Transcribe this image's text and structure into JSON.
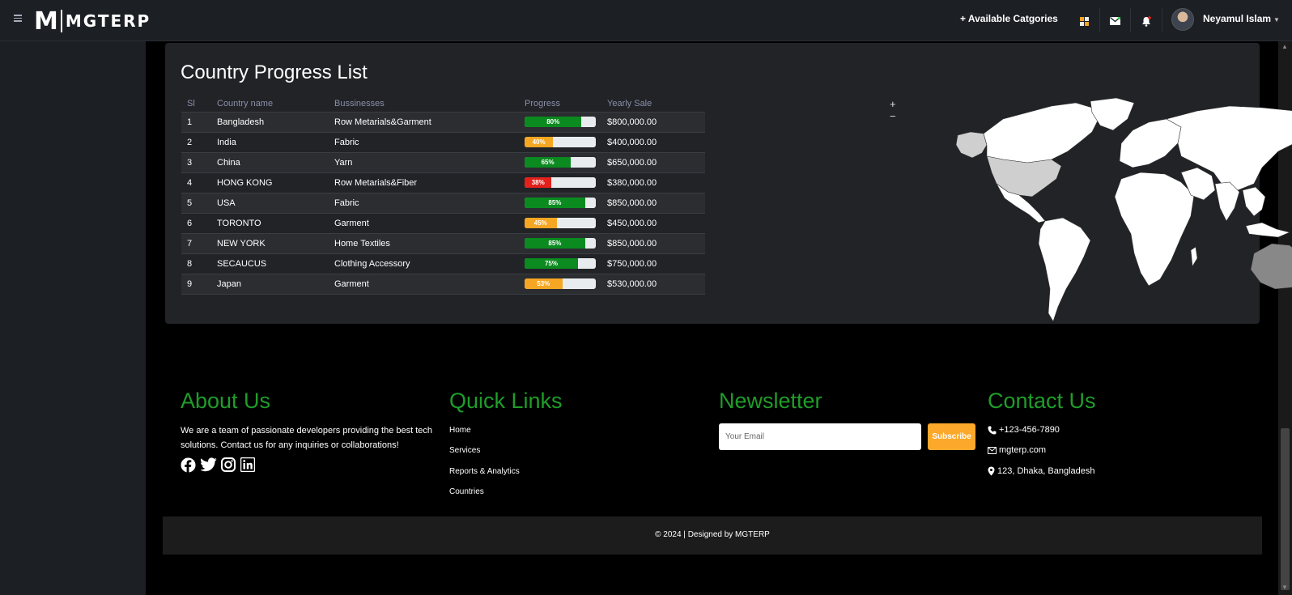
{
  "header": {
    "logo_letter": "M",
    "logo_text": "MGTERP",
    "available_categories": "+ Available Catgories",
    "icons": [
      "grid-icon",
      "mail-icon",
      "bell-icon"
    ],
    "user_name": "Neyamul Islam"
  },
  "card": {
    "title": "Country Progress List",
    "columns": [
      "Sl",
      "Country name",
      "Bussinesses",
      "Progress",
      "Yearly Sale"
    ],
    "rows": [
      {
        "sl": "1",
        "country": "Bangladesh",
        "business": "Row Metarials&Garment",
        "progress": 80,
        "progress_label": "80%",
        "color": "#0a8a1f",
        "sale": "$800,000.00"
      },
      {
        "sl": "2",
        "country": "India",
        "business": "Fabric",
        "progress": 40,
        "progress_label": "40%",
        "color": "#f5a623",
        "sale": "$400,000.00"
      },
      {
        "sl": "3",
        "country": "China",
        "business": "Yarn",
        "progress": 65,
        "progress_label": "65%",
        "color": "#0a8a1f",
        "sale": "$650,000.00"
      },
      {
        "sl": "4",
        "country": "HONG KONG",
        "business": "Row Metarials&Fiber",
        "progress": 38,
        "progress_label": "38%",
        "color": "#e3201b",
        "sale": "$380,000.00"
      },
      {
        "sl": "5",
        "country": "USA",
        "business": "Fabric",
        "progress": 85,
        "progress_label": "85%",
        "color": "#0a8a1f",
        "sale": "$850,000.00"
      },
      {
        "sl": "6",
        "country": "TORONTO",
        "business": "Garment",
        "progress": 45,
        "progress_label": "45%",
        "color": "#f5a623",
        "sale": "$450,000.00"
      },
      {
        "sl": "7",
        "country": "NEW YORK",
        "business": "Home Textiles",
        "progress": 85,
        "progress_label": "85%",
        "color": "#0a8a1f",
        "sale": "$850,000.00"
      },
      {
        "sl": "8",
        "country": "SECAUCUS",
        "business": "Clothing Accessory",
        "progress": 75,
        "progress_label": "75%",
        "color": "#0a8a1f",
        "sale": "$750,000.00"
      },
      {
        "sl": "9",
        "country": "Japan",
        "business": "Garment",
        "progress": 53,
        "progress_label": "53%",
        "color": "#f5a623",
        "sale": "$530,000.00"
      }
    ],
    "zoom_in": "+",
    "zoom_out": "−"
  },
  "footer": {
    "about_title": "About Us",
    "about_text": "We are a team of passionate developers providing the best tech solutions. Contact us for any inquiries or collaborations!",
    "social_icons": [
      "facebook-icon",
      "twitter-icon",
      "instagram-icon",
      "linkedin-icon"
    ],
    "quick_links_title": "Quick Links",
    "quick_links": [
      "Home",
      "Services",
      "Reports & Analytics",
      "Countries"
    ],
    "newsletter_title": "Newsletter",
    "email_placeholder": "Your Email",
    "subscribe_label": "Subscribe",
    "contact_title": "Contact Us",
    "phone": "+123-456-7890",
    "email": "mgterp.com",
    "address": "123, Dhaka, Bangladesh",
    "copyright": "© 2024 | Designed by MGTERP"
  },
  "colors": {
    "accent_green": "#1f9d29",
    "subscribe_orange": "#fca82a",
    "card_bg": "#212327",
    "topbar_bg": "#1c1f24"
  }
}
